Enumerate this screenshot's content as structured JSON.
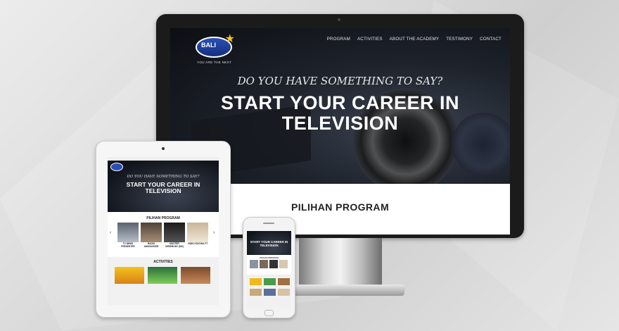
{
  "site": {
    "logo_text": "BALI",
    "tagline": "YOU ARE THE NEXT",
    "nav": [
      "PROGRAM",
      "ACTIVITIES",
      "ABOUT THE ACADEMY",
      "TESTIMONY",
      "CONTACT"
    ],
    "hero_subtitle": "DO YOU HAVE SOMETHING TO SAY?",
    "hero_title_line1": "START YOUR CAREER IN",
    "hero_title_line2": "TELEVISION",
    "section_title": "PILIHAN PROGRAM"
  },
  "tablet": {
    "hero_subtitle": "DO YOU HAVE SOMETHING TO SAY?",
    "hero_title_line1": "START YOUR CAREER IN",
    "hero_title_line2": "TELEVISION",
    "section_title": "PILIHAN PROGRAM",
    "programs": [
      "TV NEWS PRESENTER",
      "RADIO ANNOUNCER",
      "MASTER CEREMONY (MC)",
      "VIDEO EDITING FT"
    ],
    "activities_title": "ACTIVITIES"
  },
  "phone": {
    "hero_title_line1": "START YOUR CAREER IN",
    "hero_title_line2": "TELEVISION",
    "section_title": "PILIHAN PROGRAM"
  },
  "colors": {
    "brand_blue": "#2a4fb5",
    "star_yellow": "#f5c518",
    "hero_dark": "#10131a"
  }
}
